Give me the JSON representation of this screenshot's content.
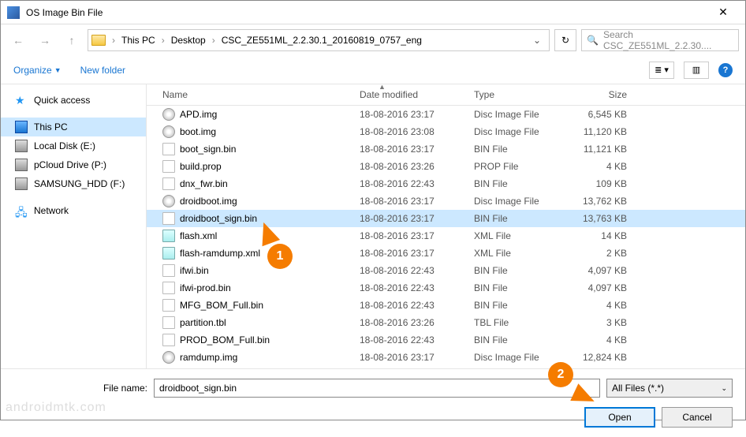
{
  "window": {
    "title": "OS Image Bin File",
    "close": "✕"
  },
  "nav": {
    "crumbs": [
      "This PC",
      "Desktop",
      "CSC_ZE551ML_2.2.30.1_20160819_0757_eng"
    ],
    "search_placeholder": "Search CSC_ZE551ML_2.2.30...."
  },
  "toolbar": {
    "organize": "Organize",
    "newfolder": "New folder"
  },
  "sidebar": {
    "items": [
      {
        "label": "Quick access",
        "icon": "star"
      },
      {
        "label": "This PC",
        "icon": "pc",
        "selected": true
      },
      {
        "label": "Local Disk (E:)",
        "icon": "disk"
      },
      {
        "label": "pCloud Drive (P:)",
        "icon": "disk"
      },
      {
        "label": "SAMSUNG_HDD (F:)",
        "icon": "disk"
      },
      {
        "label": "Network",
        "icon": "net"
      }
    ]
  },
  "columns": {
    "name": "Name",
    "date": "Date modified",
    "type": "Type",
    "size": "Size"
  },
  "files": [
    {
      "name": "APD.img",
      "date": "18-08-2016 23:17",
      "type": "Disc Image File",
      "size": "6,545 KB",
      "icon": "disc"
    },
    {
      "name": "boot.img",
      "date": "18-08-2016 23:08",
      "type": "Disc Image File",
      "size": "11,120 KB",
      "icon": "disc"
    },
    {
      "name": "boot_sign.bin",
      "date": "18-08-2016 23:17",
      "type": "BIN File",
      "size": "11,121 KB",
      "icon": "file"
    },
    {
      "name": "build.prop",
      "date": "18-08-2016 23:26",
      "type": "PROP File",
      "size": "4 KB",
      "icon": "file"
    },
    {
      "name": "dnx_fwr.bin",
      "date": "18-08-2016 22:43",
      "type": "BIN File",
      "size": "109 KB",
      "icon": "file"
    },
    {
      "name": "droidboot.img",
      "date": "18-08-2016 23:17",
      "type": "Disc Image File",
      "size": "13,762 KB",
      "icon": "disc"
    },
    {
      "name": "droidboot_sign.bin",
      "date": "18-08-2016 23:17",
      "type": "BIN File",
      "size": "13,763 KB",
      "icon": "file",
      "selected": true
    },
    {
      "name": "flash.xml",
      "date": "18-08-2016 23:17",
      "type": "XML File",
      "size": "14 KB",
      "icon": "xml"
    },
    {
      "name": "flash-ramdump.xml",
      "date": "18-08-2016 23:17",
      "type": "XML File",
      "size": "2 KB",
      "icon": "xml"
    },
    {
      "name": "ifwi.bin",
      "date": "18-08-2016 22:43",
      "type": "BIN File",
      "size": "4,097 KB",
      "icon": "file"
    },
    {
      "name": "ifwi-prod.bin",
      "date": "18-08-2016 22:43",
      "type": "BIN File",
      "size": "4,097 KB",
      "icon": "file"
    },
    {
      "name": "MFG_BOM_Full.bin",
      "date": "18-08-2016 22:43",
      "type": "BIN File",
      "size": "4 KB",
      "icon": "file"
    },
    {
      "name": "partition.tbl",
      "date": "18-08-2016 23:26",
      "type": "TBL File",
      "size": "3 KB",
      "icon": "file"
    },
    {
      "name": "PROD_BOM_Full.bin",
      "date": "18-08-2016 22:43",
      "type": "BIN File",
      "size": "4 KB",
      "icon": "file"
    },
    {
      "name": "ramdump.img",
      "date": "18-08-2016 23:17",
      "type": "Disc Image File",
      "size": "12,824 KB",
      "icon": "disc"
    }
  ],
  "footer": {
    "fname_label": "File name:",
    "fname_value": "droidboot_sign.bin",
    "filetype": "All Files (*.*)",
    "open": "Open",
    "cancel": "Cancel"
  },
  "callouts": {
    "one": "1",
    "two": "2"
  },
  "watermark": "androidmtk.com"
}
